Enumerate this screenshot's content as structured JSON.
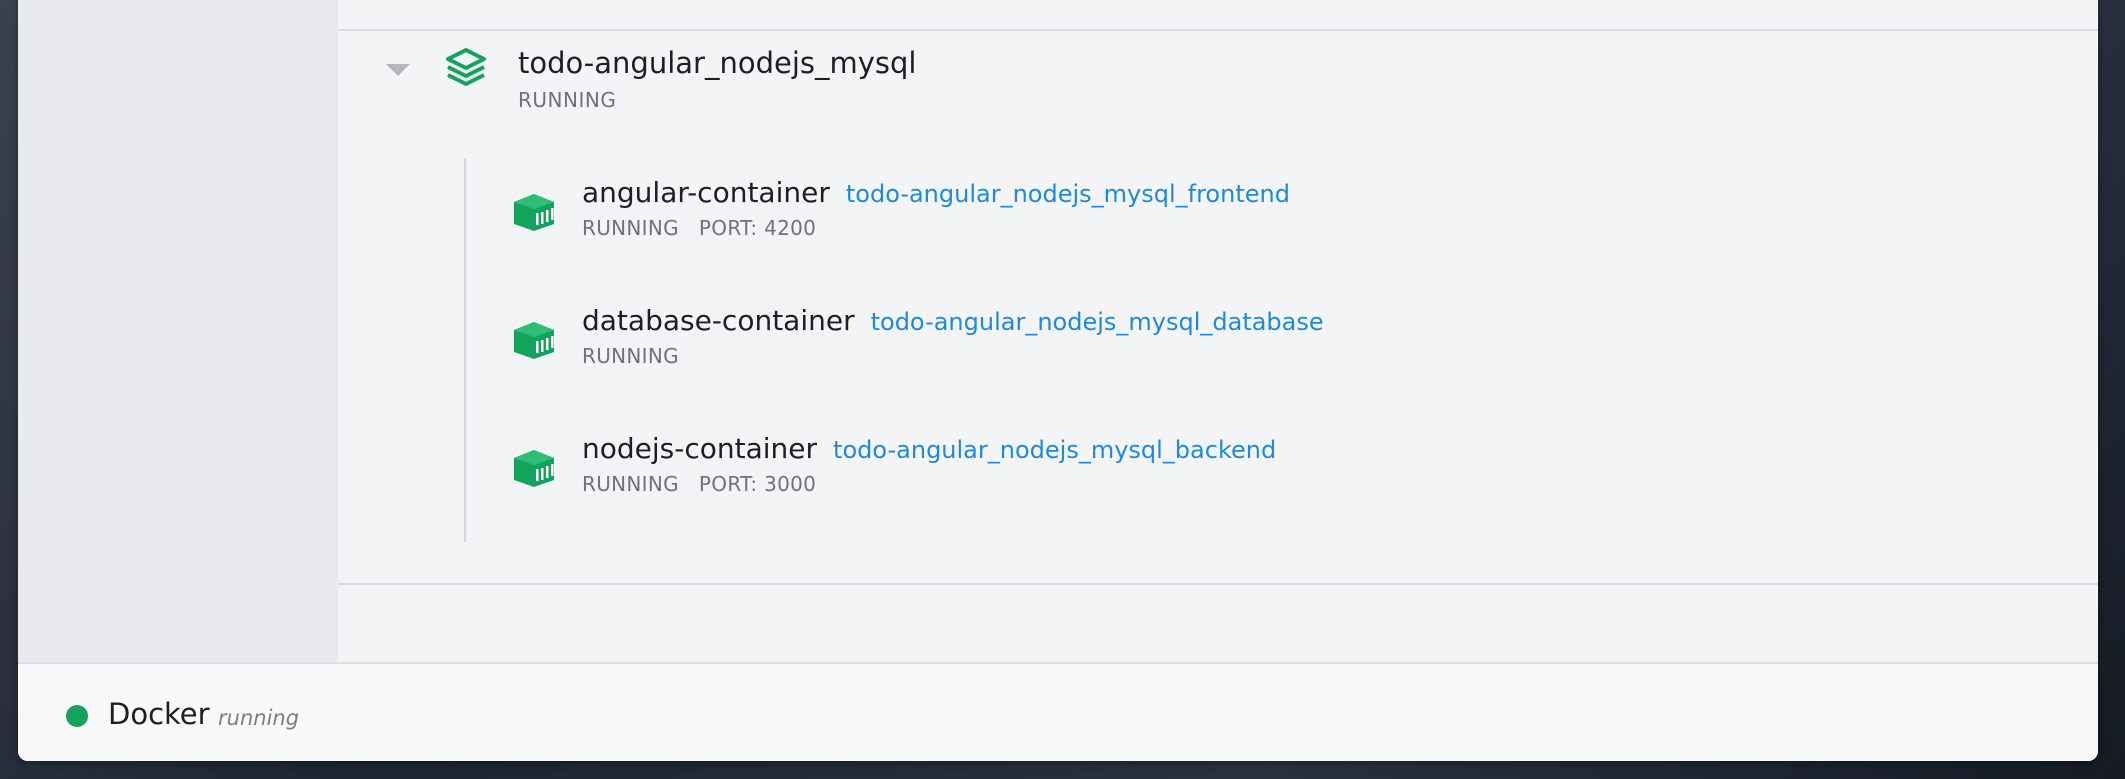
{
  "stack": {
    "name": "todo-angular_nodejs_mysql",
    "status": "RUNNING",
    "icon": "layers-icon",
    "accent_color": "#13a35c"
  },
  "containers": [
    {
      "name": "angular-container",
      "image": "todo-angular_nodejs_mysql_frontend",
      "status": "RUNNING",
      "port": "PORT: 4200",
      "icon": "container-icon"
    },
    {
      "name": "database-container",
      "image": "todo-angular_nodejs_mysql_database",
      "status": "RUNNING",
      "port": "",
      "icon": "container-icon"
    },
    {
      "name": "nodejs-container",
      "image": "todo-angular_nodejs_mysql_backend",
      "status": "RUNNING",
      "port": "PORT: 3000",
      "icon": "container-icon"
    }
  ],
  "statusbar": {
    "app_name": "Docker",
    "state": "running",
    "dot_color": "#13a35c"
  },
  "colors": {
    "link": "#1f8ad9",
    "running_green": "#13a35c"
  }
}
